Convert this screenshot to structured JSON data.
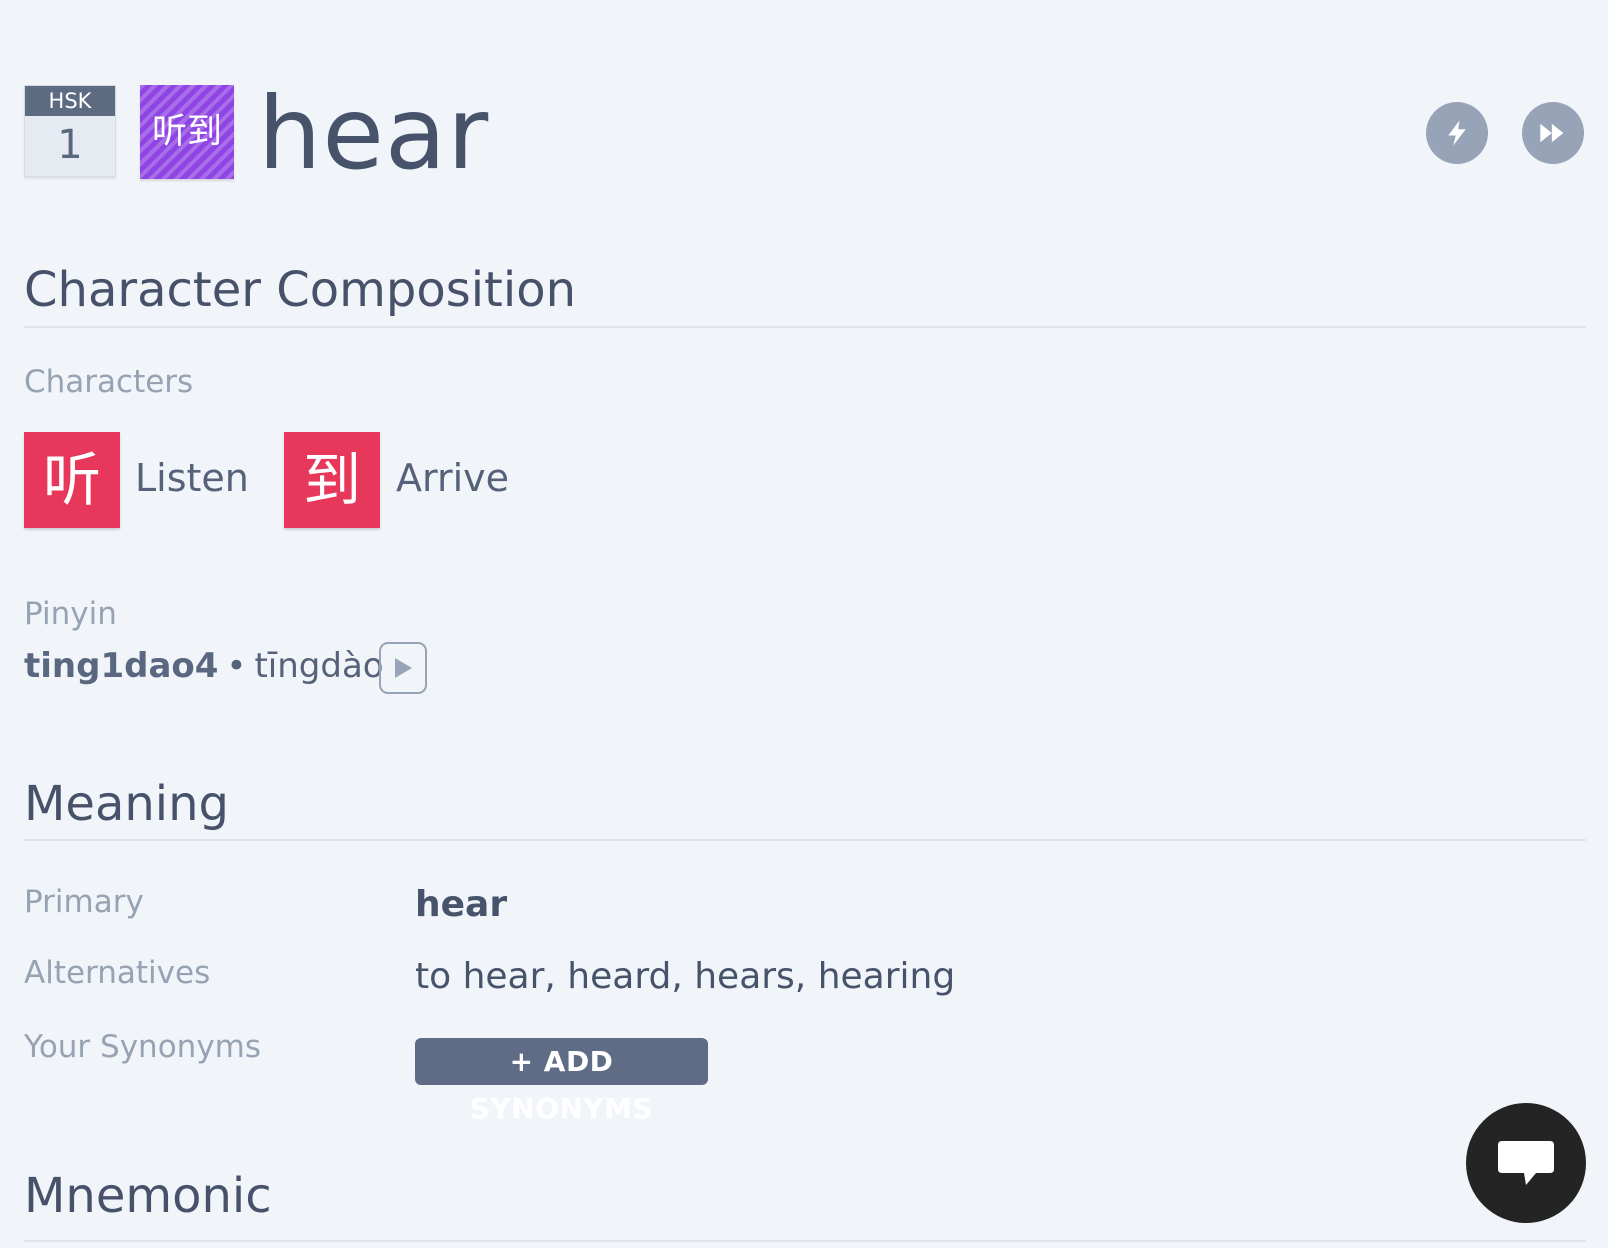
{
  "header": {
    "hsk_label": "HSK",
    "hsk_level": "1",
    "word_hanzi": "听到",
    "word_title": "hear",
    "actions": [
      {
        "icon": "lightning-icon"
      },
      {
        "icon": "fast-forward-icon"
      }
    ]
  },
  "composition": {
    "title": "Character Composition",
    "characters_label": "Characters",
    "characters": [
      {
        "hanzi": "听",
        "meaning": "Listen"
      },
      {
        "hanzi": "到",
        "meaning": "Arrive"
      }
    ],
    "pinyin_label": "Pinyin",
    "pinyin_numbered": "ting1dao4",
    "separator": "•",
    "pinyin_tones": "tīngdào"
  },
  "meaning": {
    "title": "Meaning",
    "primary_label": "Primary",
    "primary_value": "hear",
    "alternatives_label": "Alternatives",
    "alternatives_value": "to hear, heard, hears, hearing",
    "synonyms_label": "Your Synonyms",
    "add_synonyms_button": "+ ADD SYNONYMS"
  },
  "mnemonic": {
    "title": "Mnemonic"
  },
  "colors": {
    "background": "#f1f5fa",
    "word_tile": "#8f45e4",
    "char_tile": "#e7375a",
    "button": "#5e6c85",
    "chat": "#242424"
  }
}
